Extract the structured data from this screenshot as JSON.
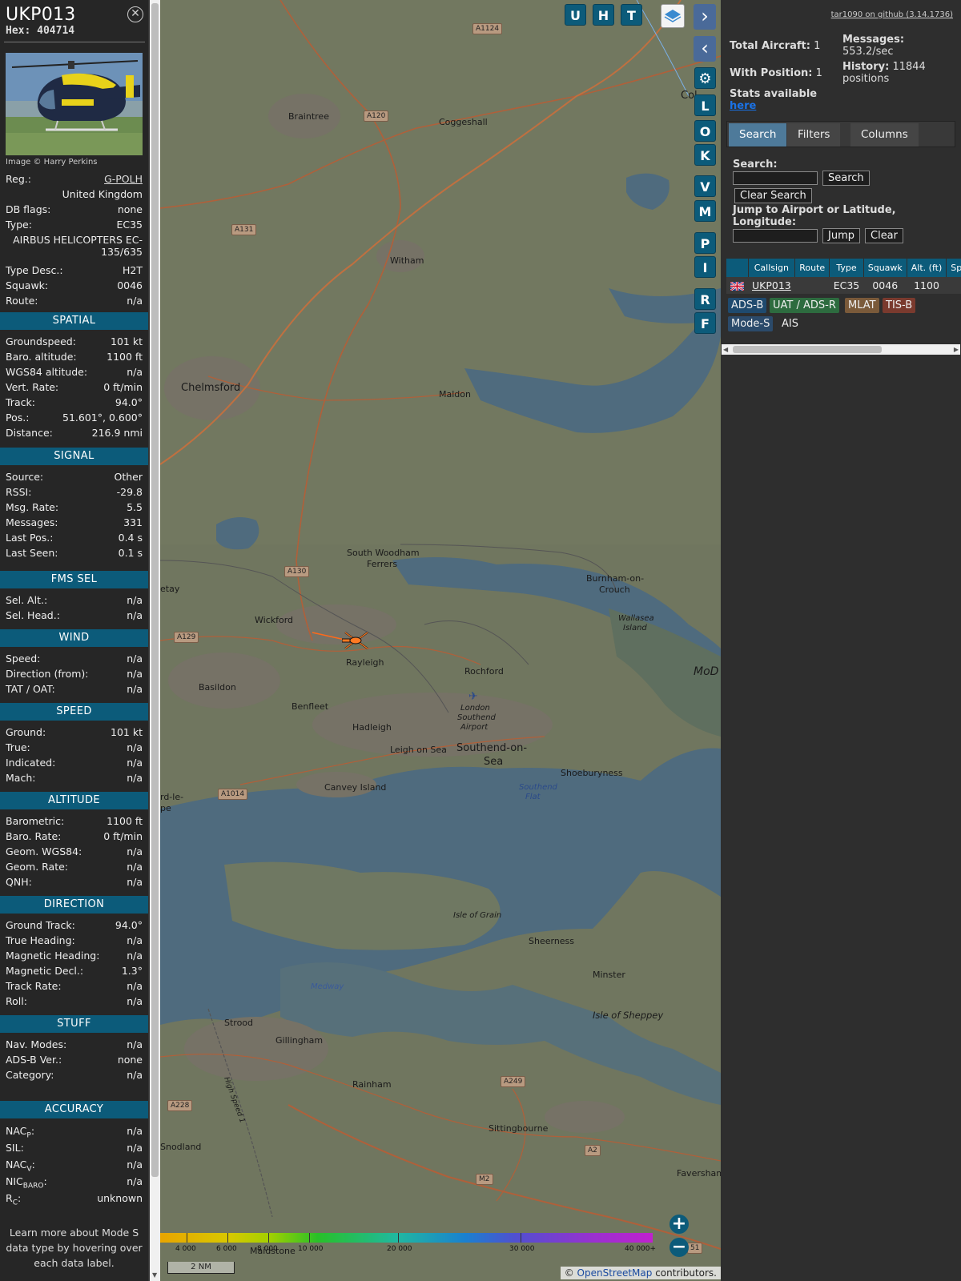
{
  "aircraft": {
    "callsign": "UKP013",
    "hex_label": "Hex:",
    "hex": "404714",
    "image_credit": "Image © Harry Perkins",
    "reg_label": "Reg.:",
    "reg": "G-POLH",
    "country": "United Kingdom",
    "db_flags_label": "DB flags:",
    "db_flags": "none",
    "type_label": "Type:",
    "type": "EC35",
    "type_full_line1": "AIRBUS HELICOPTERS EC-",
    "type_full_line2": "135/635",
    "type_desc_label": "Type Desc.:",
    "type_desc": "H2T",
    "squawk_label": "Squawk:",
    "squawk": "0046",
    "route_label": "Route:",
    "route": "n/a"
  },
  "sections": {
    "spatial": {
      "title": "SPATIAL",
      "rows": [
        {
          "k": "Groundspeed:",
          "v": "101 kt"
        },
        {
          "k": "Baro. altitude:",
          "v": "1100 ft"
        },
        {
          "k": "WGS84 altitude:",
          "v": "n/a"
        },
        {
          "k": "Vert. Rate:",
          "v": "0 ft/min"
        },
        {
          "k": "Track:",
          "v": "94.0°"
        },
        {
          "k": "Pos.:",
          "v": "51.601°, 0.600°"
        },
        {
          "k": "Distance:",
          "v": "216.9 nmi"
        }
      ]
    },
    "signal": {
      "title": "SIGNAL",
      "rows": [
        {
          "k": "Source:",
          "v": "Other"
        },
        {
          "k": "RSSI:",
          "v": "-29.8"
        },
        {
          "k": "Msg. Rate:",
          "v": "5.5"
        },
        {
          "k": "Messages:",
          "v": "331"
        },
        {
          "k": "Last Pos.:",
          "v": "0.4 s"
        },
        {
          "k": "Last Seen:",
          "v": "0.1 s"
        }
      ]
    },
    "fms": {
      "title": "FMS SEL",
      "rows": [
        {
          "k": "Sel. Alt.:",
          "v": "n/a"
        },
        {
          "k": "Sel. Head.:",
          "v": "n/a"
        }
      ]
    },
    "wind": {
      "title": "WIND",
      "rows": [
        {
          "k": "Speed:",
          "v": "n/a"
        },
        {
          "k": "Direction (from):",
          "v": "n/a"
        },
        {
          "k": "TAT / OAT:",
          "v": "n/a"
        }
      ]
    },
    "speed": {
      "title": "SPEED",
      "rows": [
        {
          "k": "Ground:",
          "v": "101 kt"
        },
        {
          "k": "True:",
          "v": "n/a"
        },
        {
          "k": "Indicated:",
          "v": "n/a"
        },
        {
          "k": "Mach:",
          "v": "n/a"
        }
      ]
    },
    "altitude": {
      "title": "ALTITUDE",
      "rows": [
        {
          "k": "Barometric:",
          "v": "1100 ft"
        },
        {
          "k": "Baro. Rate:",
          "v": "0 ft/min"
        },
        {
          "k": "Geom. WGS84:",
          "v": "n/a"
        },
        {
          "k": "Geom. Rate:",
          "v": "n/a"
        },
        {
          "k": "QNH:",
          "v": "n/a"
        }
      ]
    },
    "direction": {
      "title": "DIRECTION",
      "rows": [
        {
          "k": "Ground Track:",
          "v": "94.0°"
        },
        {
          "k": "True Heading:",
          "v": "n/a"
        },
        {
          "k": "Magnetic Heading:",
          "v": "n/a"
        },
        {
          "k": "Magnetic Decl.:",
          "v": "1.3°"
        },
        {
          "k": "Track Rate:",
          "v": "n/a"
        },
        {
          "k": "Roll:",
          "v": "n/a"
        }
      ]
    },
    "stuff": {
      "title": "STUFF",
      "rows": [
        {
          "k": "Nav. Modes:",
          "v": "n/a"
        },
        {
          "k": "ADS-B Ver.:",
          "v": "none"
        },
        {
          "k": "Category:",
          "v": "n/a"
        }
      ]
    },
    "accuracy": {
      "title": "ACCURACY",
      "rows": [
        {
          "k": "NAC",
          "sub": "P",
          "v": "n/a"
        },
        {
          "k": "SIL:",
          "sub": "",
          "v": "n/a"
        },
        {
          "k": "NAC",
          "sub": "V",
          "v": "n/a"
        },
        {
          "k": "NIC",
          "sub": "BARO",
          "v": "n/a"
        },
        {
          "k": "R",
          "sub": "C",
          "v": "unknown"
        }
      ]
    }
  },
  "learn_more": "Learn more about Mode S data type by hovering over each data label.",
  "map": {
    "buttons": [
      "U",
      "H",
      "T"
    ],
    "side_buttons": [
      "L",
      "O",
      "K",
      "V",
      "M",
      "P",
      "I",
      "R",
      "F"
    ],
    "labels": {
      "braintree": "Braintree",
      "coggeshall": "Coggeshall",
      "witham": "Witham",
      "chelmsford": "Chelmsford",
      "maldon": "Maldon",
      "swf1": "South Woodham",
      "swf2": "Ferrers",
      "burnham1": "Burnham-on-",
      "burnham2": "Crouch",
      "wallasea1": "Wallasea",
      "wallasea2": "Island",
      "wickford": "Wickford",
      "rayleigh": "Rayleigh",
      "rochford": "Rochford",
      "basildon": "Basildon",
      "benfleet": "Benfleet",
      "hadleigh": "Hadleigh",
      "leigh": "Leigh on Sea",
      "southend1": "Southend-on-",
      "southend2": "Sea",
      "airport1": "London",
      "airport2": "Southend",
      "airport3": "Airport",
      "shoebury": "Shoeburyness",
      "canvey": "Canvey Island",
      "southend_flat1": "Southend",
      "southend_flat2": "Flat",
      "isle_grain": "Isle of Grain",
      "sheerness": "Sheerness",
      "minster": "Minster",
      "sheppey": "Isle of Sheppey",
      "medway": "Medway",
      "strood": "Strood",
      "gillingham": "Gillingham",
      "rainham": "Rainham",
      "sittingbourne": "Sittingbourne",
      "faversham": "Faversham",
      "snodland": "Snodland",
      "maidstone": "Maidstone",
      "mod": "MoD",
      "col": "Col",
      "thurrock1": "rd-le-",
      "thurrock2": "pe",
      "etay": "etay",
      "high_speed": "High Speed 1"
    },
    "roads": {
      "a1124": "A1124",
      "a120": "A120",
      "a131": "A131",
      "a130": "A130",
      "a129": "A129",
      "a1014": "A1014",
      "a249": "A249",
      "a228": "A228",
      "a2": "A2",
      "m2": "M2",
      "r51": "51"
    },
    "altitude_scale": [
      "4 000",
      "6 000",
      "8 000",
      "10 000",
      "20 000",
      "30 000",
      "40 000+"
    ],
    "scale_bar": "2 NM",
    "attribution_prefix": "© ",
    "attribution_link": "OpenStreetMap",
    "attribution_suffix": " contributors."
  },
  "side": {
    "github": "tar1090 on github (3.14.1736)",
    "total_aircraft_label": "Total Aircraft:",
    "total_aircraft": "1",
    "with_position_label": "With Position:",
    "with_position": "1",
    "stats_label": "Stats available",
    "stats_link": "here",
    "messages_label": "Messages:",
    "messages_value": "553.2/sec",
    "history_label": "History:",
    "history_value": "11844",
    "history_unit": "positions",
    "tabs": [
      "Search",
      "Filters",
      "Columns"
    ],
    "search_label": "Search:",
    "search_button": "Search",
    "clear_search_button": "Clear Search",
    "jump_label": "Jump to Airport or Latitude, Longitude:",
    "jump_button": "Jump",
    "clear_button": "Clear",
    "table": {
      "headers": [
        "",
        "Callsign",
        "Route",
        "Type",
        "Squawk",
        "Alt. (ft)",
        "Spd."
      ],
      "rows": [
        {
          "flag": "uk-flag-icon",
          "callsign": "UKP013",
          "route": "",
          "type": "EC35",
          "squawk": "0046",
          "alt": "1100",
          "spd": ""
        }
      ]
    },
    "sources": [
      {
        "label": "ADS-B",
        "color": "#1f4a6e"
      },
      {
        "label": "UAT / ADS-R",
        "color": "#2d6b3f"
      },
      {
        "label": "MLAT",
        "color": "#7a5a3a"
      },
      {
        "label": "TIS-B",
        "color": "#7a3a2e"
      },
      {
        "label": "Mode-S",
        "color": "#2b4a6a"
      },
      {
        "label": "AIS",
        "color": ""
      }
    ]
  },
  "colors": {
    "accent": "#0c5b7a",
    "track": "#ff6a1a"
  }
}
